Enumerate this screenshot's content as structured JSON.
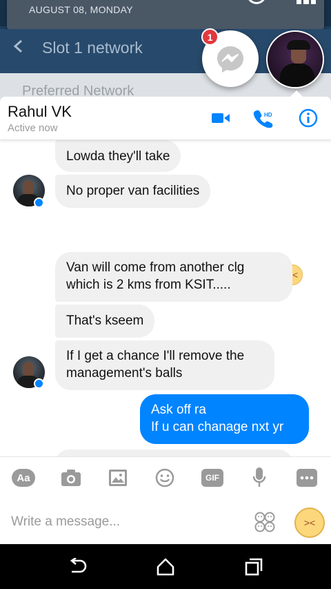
{
  "background": {
    "notification_date": "AUGUST 08, MONDAY",
    "toolbar_title": "Slot 1 network",
    "list_item": "Preferred Network"
  },
  "chathead": {
    "unread_count": "1"
  },
  "conversation": {
    "contact_name": "Rahul VK",
    "presence": "Active now",
    "header_icons": [
      "video-call-icon",
      "hd-call-icon",
      "info-icon"
    ]
  },
  "messages": [
    {
      "text": "Lowda they'll take",
      "from": "them"
    },
    {
      "text": "No proper van facilities",
      "from": "them"
    },
    {
      "text": "Van will come from another clg which is 2 kms from KSIT.....",
      "from": "them"
    },
    {
      "text": "That's kseem",
      "from": "them"
    },
    {
      "text": "If I get a chance I'll remove the management's balls",
      "from": "them"
    },
    {
      "text": "Ask off ra\nIf u can chanage nxt yr",
      "from": "me"
    }
  ],
  "composer": {
    "placeholder": "Write a message...",
    "tool_labels": {
      "text": "Aa",
      "gif": "GIF"
    }
  },
  "colors": {
    "accent": "#0084ff",
    "incoming_bubble": "#f1f0f0",
    "badge": "#e0393e"
  }
}
